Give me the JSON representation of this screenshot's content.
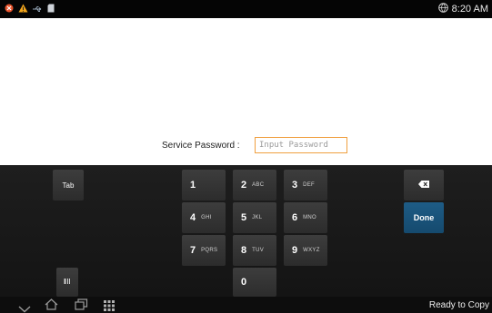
{
  "status_bar": {
    "time": "8:20 AM",
    "icons": [
      "notification-dot-icon",
      "warning-icon",
      "usb-icon",
      "sd-card-icon",
      "world-clock-icon"
    ]
  },
  "form": {
    "label": "Service Password :",
    "placeholder": "Input Password",
    "value": ""
  },
  "keyboard": {
    "tab_label": "Tab",
    "backspace_icon": "backspace-icon",
    "done_label": "Done",
    "settings_icon": "keyboard-settings-icon",
    "keys": [
      {
        "num": "1",
        "letters": ""
      },
      {
        "num": "2",
        "letters": "ABC"
      },
      {
        "num": "3",
        "letters": "DEF"
      },
      {
        "num": "4",
        "letters": "GHI"
      },
      {
        "num": "5",
        "letters": "JKL"
      },
      {
        "num": "6",
        "letters": "MNO"
      },
      {
        "num": "7",
        "letters": "PQRS"
      },
      {
        "num": "8",
        "letters": "TUV"
      },
      {
        "num": "9",
        "letters": "WXYZ"
      },
      {
        "num": "0",
        "letters": ""
      }
    ]
  },
  "nav_bar": {
    "icons": [
      "hide-keyboard-icon",
      "home-icon",
      "recent-apps-icon",
      "apps-grid-icon"
    ],
    "status": "Ready to Copy"
  },
  "colors": {
    "accent_done": "#1e5c86",
    "input_focus_border": "#f0a040",
    "keyboard_bg": "#1a1a1a"
  }
}
